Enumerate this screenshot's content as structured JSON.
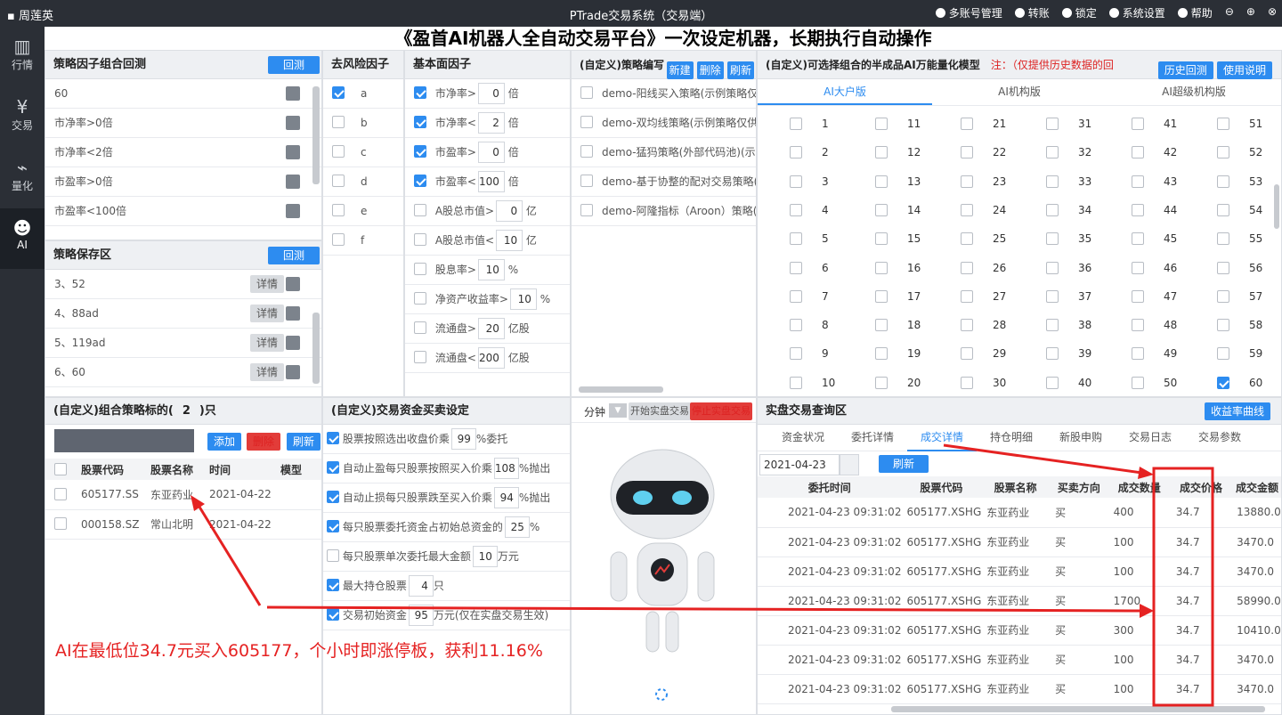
{
  "window": {
    "user": "周莲英",
    "title": "PTrade交易系统（交易端）",
    "menu": [
      "多账号管理",
      "转账",
      "锁定",
      "系统设置",
      "帮助"
    ]
  },
  "nav": [
    "行情",
    "交易",
    "量化",
    "AI"
  ],
  "banner": "《盈首AI机器人全自动交易平台》一次设定机器，长期执行自动操作",
  "factor_combo": {
    "title": "策略因子组合回测",
    "btn": "回测",
    "rows": [
      "60",
      "市净率>0倍",
      "市净率<2倍",
      "市盈率>0倍",
      "市盈率<100倍"
    ]
  },
  "save_zone": {
    "title": "策略保存区",
    "btn": "回测",
    "detail": "详情",
    "rows": [
      "3、52",
      "4、88ad",
      "5、119ad",
      "6、60"
    ]
  },
  "risk": {
    "title": "去风险因子",
    "items": [
      {
        "l": "a",
        "on": true
      },
      {
        "l": "b",
        "on": false
      },
      {
        "l": "c",
        "on": false
      },
      {
        "l": "d",
        "on": false
      },
      {
        "l": "e",
        "on": false
      },
      {
        "l": "f",
        "on": false
      }
    ]
  },
  "fund": {
    "title": "基本面因子",
    "items": [
      {
        "l": "市净率>",
        "v": "0",
        "u": "倍",
        "on": true
      },
      {
        "l": "市净率<",
        "v": "2",
        "u": "倍",
        "on": true
      },
      {
        "l": "市盈率>",
        "v": "0",
        "u": "倍",
        "on": true
      },
      {
        "l": "市盈率<",
        "v": "100",
        "u": "倍",
        "on": true
      },
      {
        "l": "A股总市值>",
        "v": "0",
        "u": "亿",
        "on": false
      },
      {
        "l": "A股总市值<",
        "v": "10",
        "u": "亿",
        "on": false
      },
      {
        "l": "股息率>",
        "v": "10",
        "u": "%",
        "on": false
      },
      {
        "l": "净资产收益率>",
        "v": "10",
        "u": "%",
        "on": false
      },
      {
        "l": "流通盘>",
        "v": "20",
        "u": "亿股",
        "on": false
      },
      {
        "l": "流通盘<",
        "v": "200",
        "u": "亿股",
        "on": false
      }
    ]
  },
  "strategy": {
    "title": "(自定义)策略编写",
    "btns": [
      "新建",
      "删除",
      "刷新"
    ],
    "items": [
      "demo-阳线买入策略(示例策略仅供",
      "demo-双均线策略(示例策略仅供参",
      "demo-猛犸策略(外部代码池)(示例",
      "demo-基于协整的配对交易策略(示",
      "demo-阿隆指标（Aroon）策略(示"
    ]
  },
  "ai_model": {
    "title": "(自定义)可选择组合的半成品AI万能量化模型",
    "note": "注：（仅提供历史数据的回",
    "btns": [
      "历史回测",
      "使用说明"
    ],
    "tabs": [
      "AI大户版",
      "AI机构版",
      "AI超级机构版"
    ],
    "checked": [
      60
    ]
  },
  "combo": {
    "title": "(自定义)组合策略标的(",
    "count": "2",
    "suffix": ")只",
    "btns": [
      "添加",
      "删除",
      "刷新"
    ],
    "cols": [
      "股票代码",
      "股票名称",
      "时间",
      "模型"
    ],
    "rows": [
      [
        "605177.SS",
        "东亚药业",
        "2021-04-22"
      ],
      [
        "000158.SZ",
        "常山北明",
        "2021-04-22"
      ]
    ]
  },
  "fundset": {
    "title": "(自定义)交易资金买卖设定",
    "items": [
      {
        "l": "股票按照选出收盘价乘",
        "v": "99",
        "u": "%委托",
        "on": true
      },
      {
        "l": "自动止盈每只股票按照买入价乘",
        "v": "108",
        "u": "%抛出",
        "on": true
      },
      {
        "l": "自动止损每只股票跌至买入价乘",
        "v": "94",
        "u": "%抛出",
        "on": true
      },
      {
        "l": "每只股票委托资金占初始总资金的",
        "v": "25",
        "u": "%",
        "on": true
      },
      {
        "l": "每只股票单次委托最大金额",
        "v": "10",
        "u": "万元",
        "on": false
      },
      {
        "l": "最大持仓股票",
        "v": "4",
        "u": "只",
        "on": true
      },
      {
        "l": "交易初始资金",
        "v": "95",
        "u": "万元(仅在实盘交易生效)",
        "on": true
      }
    ]
  },
  "robot": {
    "period": "分钟",
    "start": "开始实盘交易",
    "stop": "停止实盘交易"
  },
  "query": {
    "title": "实盘交易查询区",
    "btn": "收益率曲线",
    "tabs": [
      "资金状况",
      "委托详情",
      "成交详情",
      "持仓明细",
      "新股申购",
      "交易日志",
      "交易参数"
    ],
    "date": "2021-04-23",
    "refresh": "刷新",
    "cols": [
      "委托时间",
      "股票代码",
      "股票名称",
      "买卖方向",
      "成交数量",
      "成交价格",
      "成交金额"
    ],
    "rows": [
      [
        "2021-04-23 09:31:02",
        "605177.XSHG",
        "东亚药业",
        "买",
        "400",
        "34.7",
        "13880.0"
      ],
      [
        "2021-04-23 09:31:02",
        "605177.XSHG",
        "东亚药业",
        "买",
        "100",
        "34.7",
        "3470.0"
      ],
      [
        "2021-04-23 09:31:02",
        "605177.XSHG",
        "东亚药业",
        "买",
        "100",
        "34.7",
        "3470.0"
      ],
      [
        "2021-04-23 09:31:02",
        "605177.XSHG",
        "东亚药业",
        "买",
        "1700",
        "34.7",
        "58990.0"
      ],
      [
        "2021-04-23 09:31:02",
        "605177.XSHG",
        "东亚药业",
        "买",
        "300",
        "34.7",
        "10410.0"
      ],
      [
        "2021-04-23 09:31:02",
        "605177.XSHG",
        "东亚药业",
        "买",
        "100",
        "34.7",
        "3470.0"
      ],
      [
        "2021-04-23 09:31:02",
        "605177.XSHG",
        "东亚药业",
        "买",
        "100",
        "34.7",
        "3470.0"
      ]
    ]
  },
  "annotation": "AI在最低位34.7元买入605177，个小时即涨停板，获利11.16%"
}
